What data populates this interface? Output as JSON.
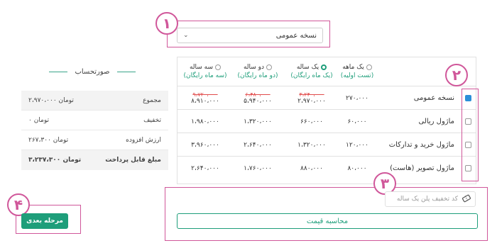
{
  "steps": {
    "one": "۱",
    "two": "۲",
    "three": "۳",
    "four": "۴"
  },
  "version_select": {
    "value": "نسخه عمومی"
  },
  "summary": {
    "title": "صورتحساب",
    "rows": [
      {
        "label": "مجموع",
        "value": "۲،۹۷۰،۰۰۰ تومان"
      },
      {
        "label": "تخفیف",
        "value": "۰ تومان"
      },
      {
        "label": "ارزش افزوده",
        "value": "۲۶۷،۳۰۰ تومان"
      },
      {
        "label": "مبلغ قابل پرداخت",
        "value": "۳،۲۳۷،۳۰۰ تومان"
      }
    ]
  },
  "plans": [
    {
      "name": "یک ماهه",
      "sub": "(تست اولیه)",
      "selected": false
    },
    {
      "name": "یک ساله",
      "sub": "(یک ماه رایگان)",
      "selected": true
    },
    {
      "name": "دو ساله",
      "sub": "(دو ماه رایگان)",
      "selected": false
    },
    {
      "name": "سه ساله",
      "sub": "(سه ماه رایگان)",
      "selected": false
    }
  ],
  "modules": [
    {
      "name": "نسخه عمومی",
      "checked": true,
      "prices": [
        "۲۷۰،۰۰۰",
        "۲،۹۷۰،۰۰۰",
        "۵،۹۴۰،۰۰۰",
        "۸،۹۱۰،۰۰۰"
      ],
      "old": [
        "",
        "۳،۲۴۰،۰۰۰",
        "۶،۴۸۰،۰۰۰",
        "۹،۷۲۰،۰۰۰"
      ]
    },
    {
      "name": "ماژول ریالی",
      "checked": false,
      "prices": [
        "۶۰،۰۰۰",
        "۶۶۰،۰۰۰",
        "۱،۳۲۰،۰۰۰",
        "۱،۹۸۰،۰۰۰"
      ]
    },
    {
      "name": "ماژول خرید و تدارکات",
      "checked": false,
      "prices": [
        "۱۲۰،۰۰۰",
        "۱،۳۲۰،۰۰۰",
        "۲،۶۴۰،۰۰۰",
        "۳،۹۶۰،۰۰۰"
      ]
    },
    {
      "name": "ماژول تصویر (هاست)",
      "checked": false,
      "prices": [
        "۸۰،۰۰۰",
        "۸۸۰،۰۰۰",
        "۱،۷۶۰،۰۰۰",
        "۲،۶۴۰،۰۰۰"
      ]
    }
  ],
  "discount": {
    "placeholder": "کد تخفیف پلن یک ساله"
  },
  "calc_button": "محاسبه قیمت",
  "next_button": "مرحله بعدی",
  "colors": {
    "accent": "#1e9e7a",
    "annotation": "#d0579a",
    "strike": "#e14b4b"
  }
}
